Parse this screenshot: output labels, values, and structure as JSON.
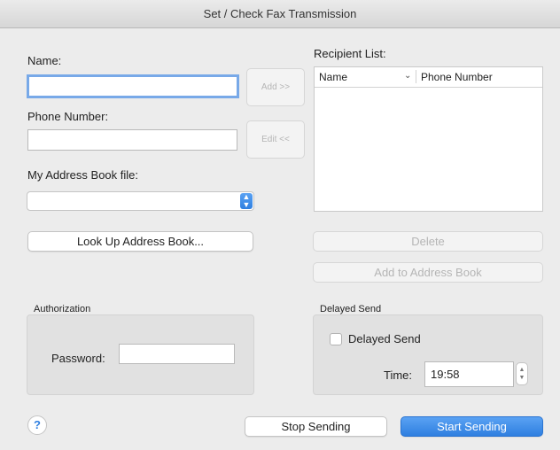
{
  "window": {
    "title": "Set / Check Fax Transmission"
  },
  "form": {
    "name_label": "Name:",
    "name_value": "",
    "phone_label": "Phone Number:",
    "phone_value": "",
    "address_book_label": "My Address Book file:",
    "address_book_value": "",
    "add_button": "Add >>",
    "edit_button": "Edit <<",
    "lookup_button": "Look Up Address Book..."
  },
  "recipients": {
    "label": "Recipient List:",
    "columns": [
      "Name",
      "Phone Number"
    ],
    "rows": [],
    "delete_button": "Delete",
    "add_to_book_button": "Add to Address Book"
  },
  "authorization": {
    "title": "Authorization",
    "password_label": "Password:",
    "password_value": ""
  },
  "delayed_send": {
    "title": "Delayed Send",
    "checkbox_label": "Delayed Send",
    "checked": false,
    "time_label": "Time:",
    "time_value": "19:58"
  },
  "footer": {
    "help_label": "?",
    "stop_button": "Stop Sending",
    "start_button": "Start Sending"
  }
}
